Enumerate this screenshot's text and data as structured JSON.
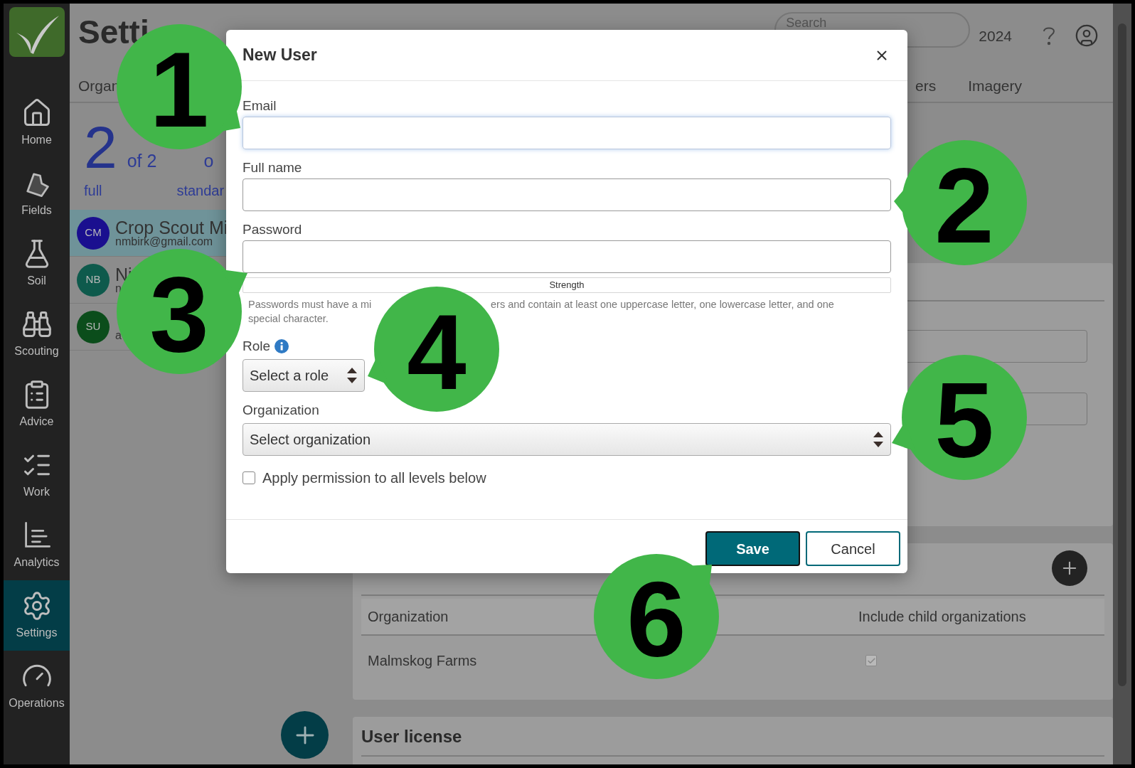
{
  "sidebar": {
    "items": [
      {
        "label": "Home",
        "selected": false
      },
      {
        "label": "Fields",
        "selected": false
      },
      {
        "label": "Soil",
        "selected": false
      },
      {
        "label": "Scouting",
        "selected": false
      },
      {
        "label": "Advice",
        "selected": false
      },
      {
        "label": "Work",
        "selected": false
      },
      {
        "label": "Analytics",
        "selected": false
      },
      {
        "label": "Settings",
        "selected": true
      },
      {
        "label": "Operations",
        "selected": false
      }
    ]
  },
  "header": {
    "title": "Setti",
    "search": {
      "placeholder": "Search"
    },
    "year": "2024"
  },
  "tabs": [
    {
      "label": "Organ"
    },
    {
      "label": "ers"
    },
    {
      "label": "Imagery"
    }
  ],
  "stats": [
    {
      "count": "2",
      "of": "of 2",
      "label": "full"
    },
    {
      "of": "o",
      "label": "standar"
    }
  ],
  "users": [
    {
      "initials": "CM",
      "name": "Crop Scout Mi",
      "email": "nmbirk@gmail.com",
      "color": "#1a0f8f",
      "selected": true
    },
    {
      "initials": "NB",
      "name": "Ni",
      "email": "n",
      "color": "#0e5a4c",
      "selected": false
    },
    {
      "initials": "SU",
      "email": "a",
      "color": "#0b4d1b",
      "selected": false
    }
  ],
  "organizations_card": {
    "columns": [
      "Organization",
      "Include child organizations"
    ],
    "rows": [
      {
        "organization": "Malmskog Farms",
        "include_children": true
      }
    ]
  },
  "license_card": {
    "title": "User license"
  },
  "dialog": {
    "title": "New User",
    "fields": [
      {
        "label": "Email",
        "focused": true
      },
      {
        "label": "Full name",
        "focused": false
      },
      {
        "label": "Password",
        "focused": false
      }
    ],
    "strength": "Strength",
    "help": [
      "Passwords must have a mi",
      "ers and contain at least one uppercase letter, one lowercase letter, and one",
      "special character."
    ],
    "role": {
      "label": "Role",
      "value": "Select a role"
    },
    "organization": {
      "label": "Organization",
      "value": "Select organization"
    },
    "apply_all": {
      "label": "Apply permission to all levels below",
      "checked": false
    },
    "buttons": [
      {
        "label": "Save",
        "kind": "primary"
      },
      {
        "label": "Cancel",
        "kind": "secondary"
      }
    ]
  },
  "callouts": [
    {
      "number": "1"
    },
    {
      "number": "2"
    },
    {
      "number": "3"
    },
    {
      "number": "4"
    },
    {
      "number": "5"
    },
    {
      "number": "6"
    }
  ]
}
